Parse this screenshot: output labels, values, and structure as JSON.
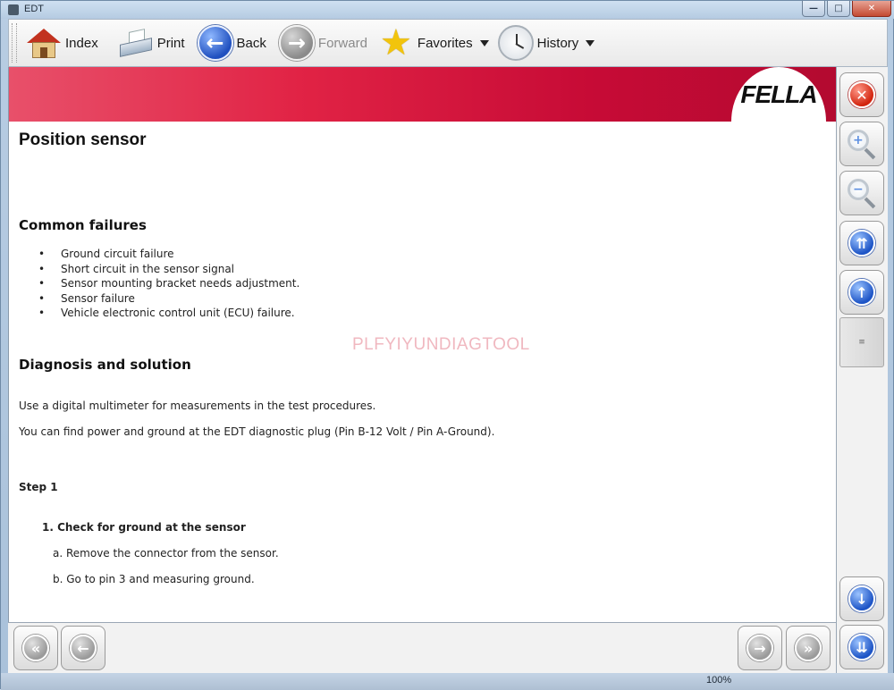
{
  "window": {
    "title": "EDT",
    "controls": {
      "minimize": "—",
      "maximize": "□",
      "close": "✕"
    }
  },
  "toolbar": {
    "index": "Index",
    "print": "Print",
    "back": "Back",
    "forward": "Forward",
    "favorites": "Favorites",
    "history": "History",
    "back_glyph": "←",
    "forward_glyph": "→",
    "star_glyph": "★"
  },
  "banner": {
    "logo": "FELLA",
    "colors": {
      "accent": "#e12345",
      "dark": "#b30a30"
    }
  },
  "document": {
    "title": "Position sensor",
    "common_failures_heading": "Common failures",
    "failures": [
      " Ground circuit failure",
      "Short circuit in the sensor signal",
      "Sensor mounting bracket needs adjustment.",
      "Sensor failure",
      "Vehicle electronic control unit (ECU) failure."
    ],
    "watermark": "PLFYIYUNDIAGTOOL",
    "diagnosis_heading": "Diagnosis and solution",
    "para1": "Use a digital multimeter for measurements in the test procedures.",
    "para2": "You can find power and ground at the EDT diagnostic plug (Pin B-12 Volt / Pin A-Ground).",
    "step_label": "Step 1",
    "step_item": "1.  Check for ground at the sensor",
    "sub_a": "a.  Remove the connector from the sensor.",
    "sub_b": "b.  Go to pin 3 and measuring ground."
  },
  "right_panel": {
    "close_glyph": "✕",
    "zoom_in_glyph": "+",
    "zoom_out_glyph": "−",
    "page_up_glyph": "⇈",
    "line_up_glyph": "↑",
    "line_down_glyph": "↓",
    "page_down_glyph": "⇊",
    "thumb_glyph": "≡"
  },
  "bottom_panel": {
    "first_glyph": "«",
    "prev_glyph": "←",
    "next_glyph": "→",
    "last_glyph": "»"
  },
  "status": {
    "zoom": "100%"
  }
}
